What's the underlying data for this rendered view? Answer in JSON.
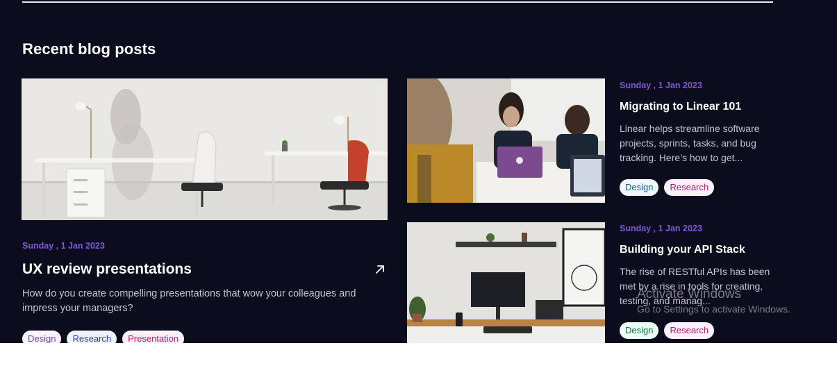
{
  "section": {
    "title": "Recent blog posts"
  },
  "featured": {
    "date": "Sunday , 1 Jan 2023",
    "title": "UX review presentations",
    "description": "How do you create compelling presentations that wow your colleagues and impress your managers?",
    "arrow_icon": "arrow-up-right-icon",
    "tags": [
      "Design",
      "Research",
      "Presentation"
    ]
  },
  "side_posts": [
    {
      "date": "Sunday , 1 Jan 2023",
      "title": "Migrating to Linear 101",
      "description": "Linear helps streamline software projects, sprints, tasks, and bug tracking. Here’s how to get...",
      "tags": [
        "Design",
        "Research"
      ]
    },
    {
      "date": "Sunday , 1 Jan 2023",
      "title": "Building your API Stack",
      "description": "The rise of RESTful APIs has been met by a rise in tools for creating, testing, and manag...",
      "tags": [
        "Design",
        "Research"
      ]
    }
  ],
  "watermark": {
    "line1": "Activate Windows",
    "line2": "Go to Settings to activate Windows."
  },
  "colors": {
    "background": "#0c0c1f",
    "accent_date": "#7f56d9"
  }
}
